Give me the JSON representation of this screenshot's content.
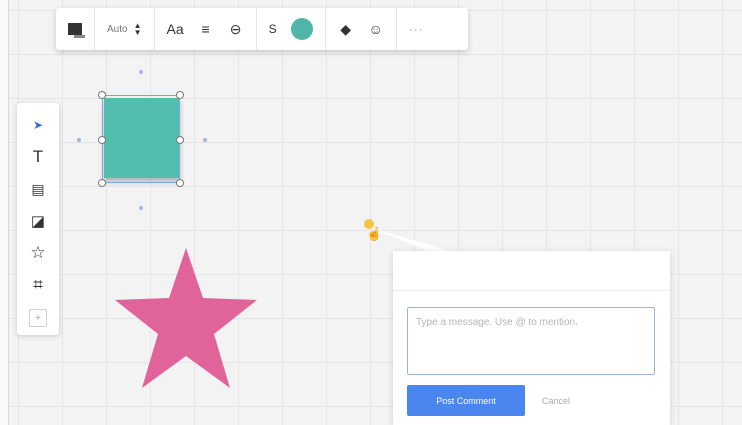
{
  "toolbar": {
    "font_size_value": "Auto",
    "text_format_label": "Aa",
    "stroke_label": "S",
    "fill_color": "#4fb5a7",
    "more_label": "···"
  },
  "rail": {
    "tools": [
      {
        "name": "select-tool",
        "icon": "pointer-icon",
        "glyph": "➤",
        "active": true
      },
      {
        "name": "text-tool",
        "icon": "text-icon",
        "glyph": "T"
      },
      {
        "name": "comment-tool",
        "icon": "comment-icon",
        "glyph": "▤"
      },
      {
        "name": "sticky-note-tool",
        "icon": "sticky-note-icon",
        "glyph": "◪"
      },
      {
        "name": "shape-tool",
        "icon": "star-icon",
        "glyph": "☆"
      },
      {
        "name": "frame-tool",
        "icon": "frame-icon",
        "glyph": "⌗"
      }
    ],
    "add_label": "+"
  },
  "canvas": {
    "sticky_color": "#52bfae",
    "star_color": "#e0649a",
    "collaborator_color": "#f5c443"
  },
  "comment": {
    "placeholder": "Type a message. Use @ to mention.",
    "post_label": "Post Comment",
    "cancel_label": "Cancel",
    "accent": "#4a86ee"
  }
}
